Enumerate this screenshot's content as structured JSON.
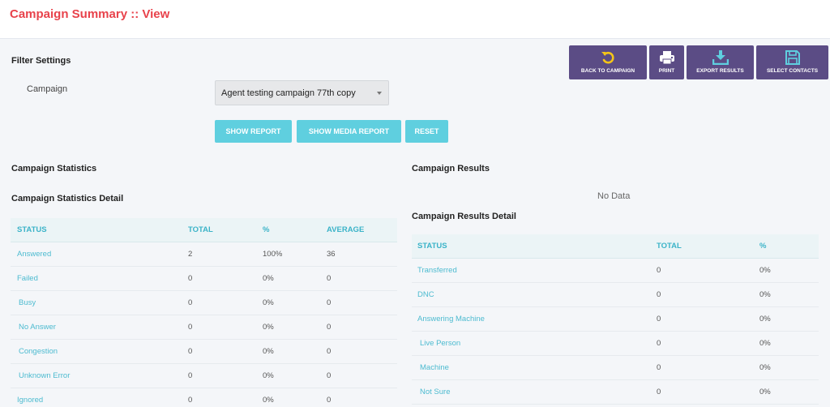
{
  "header": {
    "title": "Campaign Summary :: View"
  },
  "filter": {
    "heading": "Filter Settings",
    "campaign_label": "Campaign",
    "campaign_value": "Agent testing campaign 77th copy",
    "show_report": "SHOW REPORT",
    "show_media_report": "SHOW MEDIA REPORT",
    "reset": "RESET"
  },
  "actions": {
    "back": "BACK TO CAMPAIGN",
    "print": "PRINT",
    "export": "EXPORT RESULTS",
    "select_contacts": "SELECT CONTACTS"
  },
  "colors": {
    "title": "#e8424b",
    "cyan_button": "#5fcfdf",
    "purple_button": "#5b4c85",
    "link": "#4dbbd0",
    "icon_yellow": "#f5c518",
    "icon_cyan": "#5fcfdf"
  },
  "icons": {
    "back": "undo-arrow-icon",
    "print": "printer-icon",
    "export": "download-icon",
    "select_contacts": "floppy-disk-icon",
    "select": "caret-down-icon"
  },
  "statistics": {
    "heading": "Campaign Statistics",
    "detail_heading": "Campaign Statistics Detail",
    "columns": [
      "STATUS",
      "TOTAL",
      "%",
      "AVERAGE"
    ],
    "rows": [
      {
        "status": "Answered",
        "total": "2",
        "pct": "100%",
        "avg": "36"
      },
      {
        "status": "Failed",
        "total": "0",
        "pct": "0%",
        "avg": "0"
      },
      {
        "status": "Busy",
        "total": "0",
        "pct": "0%",
        "avg": "0"
      },
      {
        "status": "No Answer",
        "total": "0",
        "pct": "0%",
        "avg": "0"
      },
      {
        "status": "Congestion",
        "total": "0",
        "pct": "0%",
        "avg": "0"
      },
      {
        "status": "Unknown Error",
        "total": "0",
        "pct": "0%",
        "avg": "0"
      },
      {
        "status": "Ignored",
        "total": "0",
        "pct": "0%",
        "avg": "0"
      }
    ]
  },
  "results": {
    "heading": "Campaign Results",
    "no_data": "No Data",
    "detail_heading": "Campaign Results Detail",
    "columns": [
      "STATUS",
      "TOTAL",
      "%"
    ],
    "rows": [
      {
        "status": "Transferred",
        "total": "0",
        "pct": "0%"
      },
      {
        "status": "DNC",
        "total": "0",
        "pct": "0%"
      },
      {
        "status": "Answering Machine",
        "total": "0",
        "pct": "0%"
      },
      {
        "status": "Live Person",
        "total": "0",
        "pct": "0%"
      },
      {
        "status": "Machine",
        "total": "0",
        "pct": "0%"
      },
      {
        "status": "Not Sure",
        "total": "0",
        "pct": "0%"
      }
    ]
  }
}
